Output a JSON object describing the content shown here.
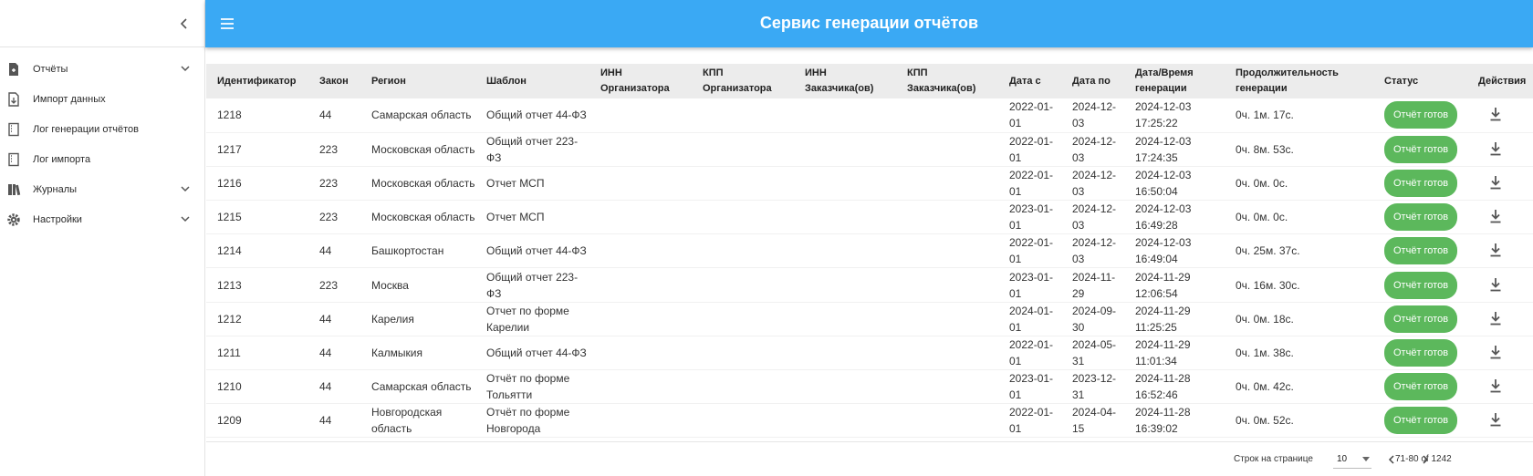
{
  "header": {
    "title": "Сервис генерации отчётов"
  },
  "sidebar": {
    "items": [
      {
        "label": "Отчёты",
        "icon": "report-icon",
        "expandable": true
      },
      {
        "label": "Импорт данных",
        "icon": "import-icon",
        "expandable": false
      },
      {
        "label": "Лог генерации отчётов",
        "icon": "log-icon",
        "expandable": false
      },
      {
        "label": "Лог импорта",
        "icon": "log-icon",
        "expandable": false
      },
      {
        "label": "Журналы",
        "icon": "journal-icon",
        "expandable": true
      },
      {
        "label": "Настройки",
        "icon": "gear-icon",
        "expandable": true
      }
    ]
  },
  "table": {
    "columns": [
      "Идентификатор",
      "Закон",
      "Регион",
      "Шаблон",
      "ИНН Организатора",
      "КПП Организатора",
      "ИНН Заказчика(ов)",
      "КПП Заказчика(ов)",
      "Дата с",
      "Дата по",
      "Дата/Время генерации",
      "Продолжительность генерации",
      "Статус",
      "Действия"
    ],
    "rows": [
      {
        "id": "1218",
        "law": "44",
        "region": "Самарская область",
        "template": "Общий отчет 44-ФЗ",
        "inn_org": "",
        "kpp_org": "",
        "inn_cust": "",
        "kpp_cust": "",
        "date_from": "2022-01-01",
        "date_to": "2024-12-03",
        "generated": "2024-12-03 17:25:22",
        "duration": "0ч. 1м. 17с.",
        "status": "Отчёт готов"
      },
      {
        "id": "1217",
        "law": "223",
        "region": "Московская область",
        "template": "Общий отчет 223-ФЗ",
        "inn_org": "",
        "kpp_org": "",
        "inn_cust": "",
        "kpp_cust": "",
        "date_from": "2022-01-01",
        "date_to": "2024-12-03",
        "generated": "2024-12-03 17:24:35",
        "duration": "0ч. 8м. 53с.",
        "status": "Отчёт готов"
      },
      {
        "id": "1216",
        "law": "223",
        "region": "Московская область",
        "template": "Отчет МСП",
        "inn_org": "",
        "kpp_org": "",
        "inn_cust": "",
        "kpp_cust": "",
        "date_from": "2022-01-01",
        "date_to": "2024-12-03",
        "generated": "2024-12-03 16:50:04",
        "duration": "0ч. 0м. 0с.",
        "status": "Отчёт готов"
      },
      {
        "id": "1215",
        "law": "223",
        "region": "Московская область",
        "template": "Отчет МСП",
        "inn_org": "",
        "kpp_org": "",
        "inn_cust": "",
        "kpp_cust": "",
        "date_from": "2023-01-01",
        "date_to": "2024-12-03",
        "generated": "2024-12-03 16:49:28",
        "duration": "0ч. 0м. 0с.",
        "status": "Отчёт готов"
      },
      {
        "id": "1214",
        "law": "44",
        "region": "Башкортостан",
        "template": "Общий отчет 44-ФЗ",
        "inn_org": "",
        "kpp_org": "",
        "inn_cust": "",
        "kpp_cust": "",
        "date_from": "2022-01-01",
        "date_to": "2024-12-03",
        "generated": "2024-12-03 16:49:04",
        "duration": "0ч. 25м. 37с.",
        "status": "Отчёт готов"
      },
      {
        "id": "1213",
        "law": "223",
        "region": "Москва",
        "template": "Общий отчет 223-ФЗ",
        "inn_org": "",
        "kpp_org": "",
        "inn_cust": "",
        "kpp_cust": "",
        "date_from": "2023-01-01",
        "date_to": "2024-11-29",
        "generated": "2024-11-29 12:06:54",
        "duration": "0ч. 16м. 30с.",
        "status": "Отчёт готов"
      },
      {
        "id": "1212",
        "law": "44",
        "region": "Карелия",
        "template": "Отчет по форме Карелии",
        "inn_org": "",
        "kpp_org": "",
        "inn_cust": "",
        "kpp_cust": "",
        "date_from": "2024-01-01",
        "date_to": "2024-09-30",
        "generated": "2024-11-29 11:25:25",
        "duration": "0ч. 0м. 18с.",
        "status": "Отчёт готов"
      },
      {
        "id": "1211",
        "law": "44",
        "region": "Калмыкия",
        "template": "Общий отчет 44-ФЗ",
        "inn_org": "",
        "kpp_org": "",
        "inn_cust": "",
        "kpp_cust": "",
        "date_from": "2022-01-01",
        "date_to": "2024-05-31",
        "generated": "2024-11-29 11:01:34",
        "duration": "0ч. 1м. 38с.",
        "status": "Отчёт готов"
      },
      {
        "id": "1210",
        "law": "44",
        "region": "Самарская область",
        "template": "Отчёт по форме Тольятти",
        "inn_org": "",
        "kpp_org": "",
        "inn_cust": "",
        "kpp_cust": "",
        "date_from": "2023-01-01",
        "date_to": "2023-12-31",
        "generated": "2024-11-28 16:52:46",
        "duration": "0ч. 0м. 42с.",
        "status": "Отчёт готов"
      },
      {
        "id": "1209",
        "law": "44",
        "region": "Новгородская область",
        "template": "Отчёт по форме Новгорода",
        "inn_org": "",
        "kpp_org": "",
        "inn_cust": "",
        "kpp_cust": "",
        "date_from": "2022-01-01",
        "date_to": "2024-04-15",
        "generated": "2024-11-28 16:39:02",
        "duration": "0ч. 0м. 52с.",
        "status": "Отчёт готов"
      }
    ]
  },
  "pagination": {
    "rows_label": "Строк на странице",
    "rows_per_page": "10",
    "range": "71-80 of 1242"
  },
  "colors": {
    "accent": "#3aa9f4",
    "status_ready": "#5cb85c"
  }
}
